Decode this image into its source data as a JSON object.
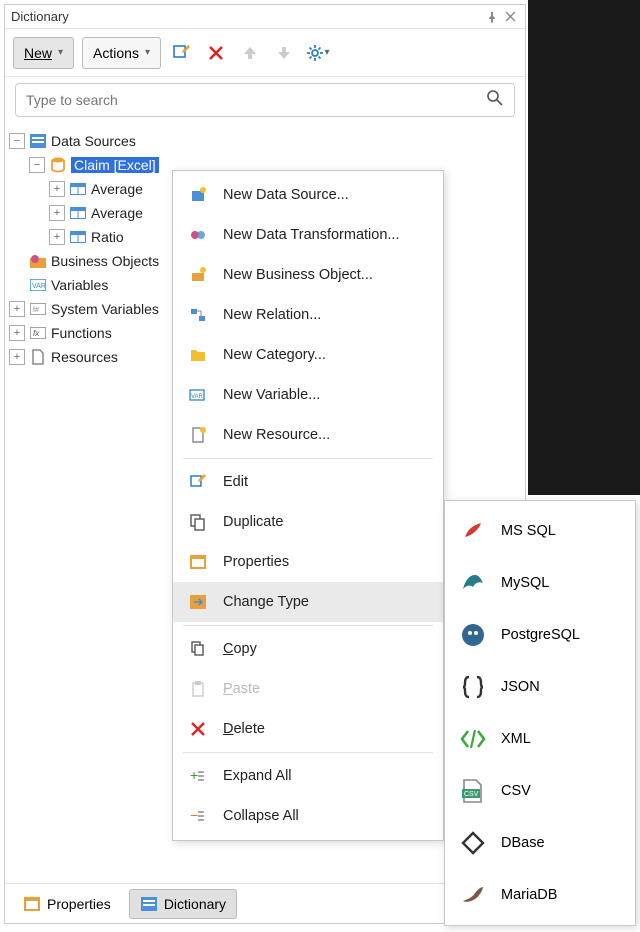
{
  "panel": {
    "title": "Dictionary"
  },
  "toolbar": {
    "new_label": "New",
    "actions_label": "Actions"
  },
  "search": {
    "placeholder": "Type to search"
  },
  "tree": {
    "root0": "Data Sources",
    "ds0": "Claim [Excel]",
    "ds0_c0": "Average",
    "ds0_c1": "Average",
    "ds0_c2": "Ratio",
    "root1": "Business Objects",
    "root2": "Variables",
    "root3": "System Variables",
    "root4": "Functions",
    "root5": "Resources"
  },
  "footer": {
    "tab0": "Properties",
    "tab1": "Dictionary"
  },
  "ctx": {
    "i0": "New Data Source...",
    "i1": "New Data Transformation...",
    "i2": "New Business Object...",
    "i3": "New Relation...",
    "i4": "New Category...",
    "i5": "New Variable...",
    "i6": "New Resource...",
    "i7": "Edit",
    "i8": "Duplicate",
    "i9": "Properties",
    "i10": "Change Type",
    "i11": "Copy",
    "i12": "Paste",
    "i13": "Delete",
    "i14": "Expand All",
    "i15": "Collapse All"
  },
  "sub": {
    "s0": "MS SQL",
    "s1": "MySQL",
    "s2": "PostgreSQL",
    "s3": "JSON",
    "s4": "XML",
    "s5": "CSV",
    "s6": "DBase",
    "s7": "MariaDB"
  }
}
